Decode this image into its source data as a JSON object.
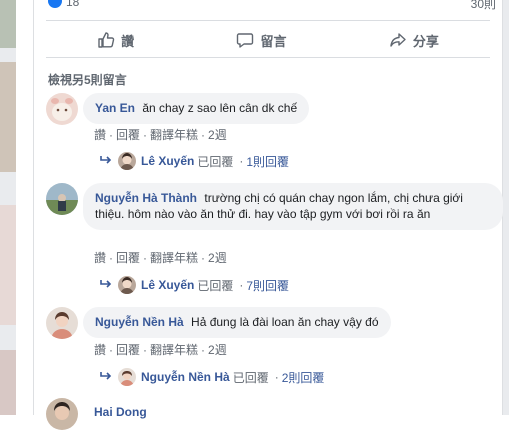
{
  "post": {
    "reaction_count": "18",
    "comment_count": "30則"
  },
  "actions": {
    "like_label": "讚",
    "comment_label": "留言",
    "share_label": "分享"
  },
  "view_more": "檢視另5則留言",
  "meta_labels": {
    "like": "讚",
    "reply": "回覆",
    "translate": "翻譯年糕",
    "dot": "·"
  },
  "comments": [
    {
      "author": "Yan En",
      "text": "ăn chay z sao lên cân dk chế",
      "time": "2週",
      "reply": {
        "name": "Lê Xuyến",
        "action": "已回覆",
        "dot": "·",
        "count": "1則回覆"
      }
    },
    {
      "author": "Nguyễn Hà Thành",
      "text": "trường chị có quán chay ngon lắm, chị chưa giới thiệu. hôm nào vào ăn thử đi. hay vào tập gym với bơi rồi ra ăn",
      "time": "2週",
      "reply": {
        "name": "Lê Xuyến",
        "action": "已回覆",
        "dot": "·",
        "count": "7則回覆"
      }
    },
    {
      "author": "Nguyễn Nền Hà",
      "text": "Hả đung là đài loan ăn chay vậy đó",
      "time": "2週",
      "reply": {
        "name": "Nguyễn Nền Hà",
        "action": "已回覆",
        "dot": "·",
        "count": "2則回覆"
      }
    },
    {
      "author": "Hai Dong"
    }
  ],
  "colors": {
    "author": "#385898",
    "bubble": "#f2f3f5",
    "meta": "#606770",
    "background": "#ffffff",
    "side_panel": "#e9ebee"
  }
}
